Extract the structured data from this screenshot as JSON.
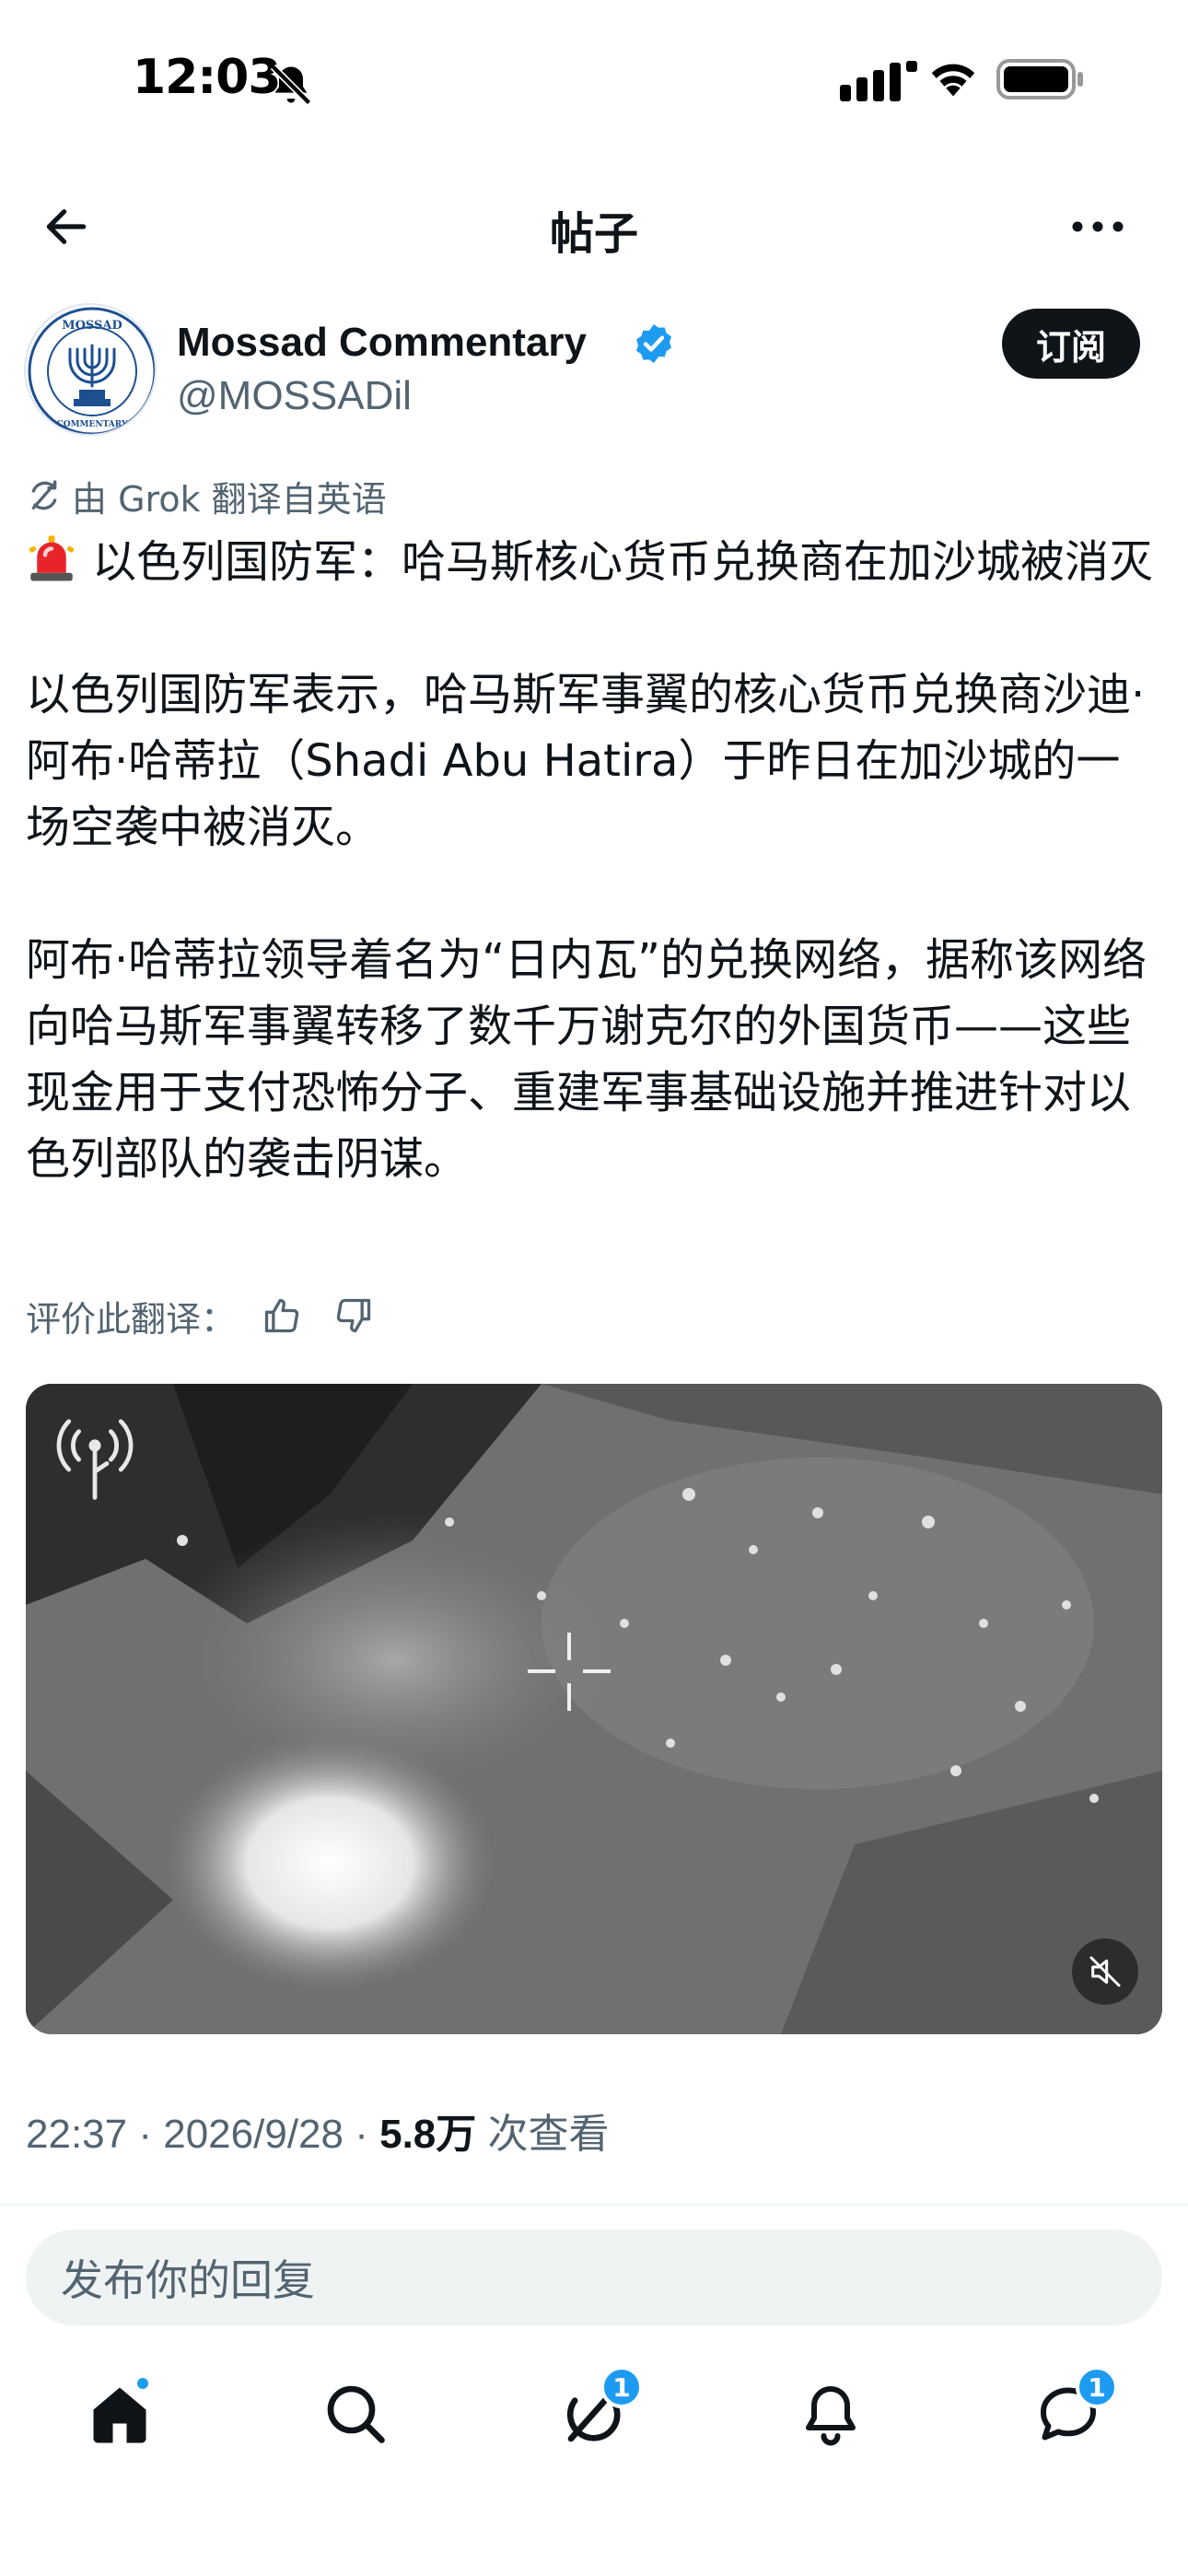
{
  "status_bar": {
    "time": "12:03"
  },
  "header": {
    "title": "帖子"
  },
  "author": {
    "name": "Mossad Commentary",
    "handle": "@MOSSADil",
    "subscribe_label": "订阅",
    "avatar_text_top": "MOSSAD",
    "avatar_text_bottom": "COMMENTARY"
  },
  "post": {
    "translation_note": "由 Grok 翻译自英语",
    "headline": "以色列国防军：哈马斯核心货币兑换商在加沙城被消灭",
    "paragraph_2": "以色列国防军表示，哈马斯军事翼的核心货币兑换商沙迪·阿布·哈蒂拉（Shadi Abu Hatira）于昨日在加沙城的一场空袭中被消灭。",
    "paragraph_3": "阿布·哈蒂拉领导着名为“日内瓦”的兑换网络，据称该网络向哈马斯军事翼转移了数千万谢克尔的外国货币——这些现金用于支付恐怖分子、重建军事基础设施并推进针对以色列部队的袭击阴谋。",
    "rate_label": "评价此翻译："
  },
  "meta": {
    "time": "22:37",
    "date": "2026/9/28",
    "views_count": "5.8万",
    "views_label": "次查看"
  },
  "reply": {
    "placeholder": "发布你的回复"
  },
  "nav": {
    "grok_badge": "1",
    "messages_badge": "1"
  },
  "colors": {
    "accent": "#1d9bf0",
    "text_primary": "#0f1419",
    "text_secondary": "#536471"
  }
}
